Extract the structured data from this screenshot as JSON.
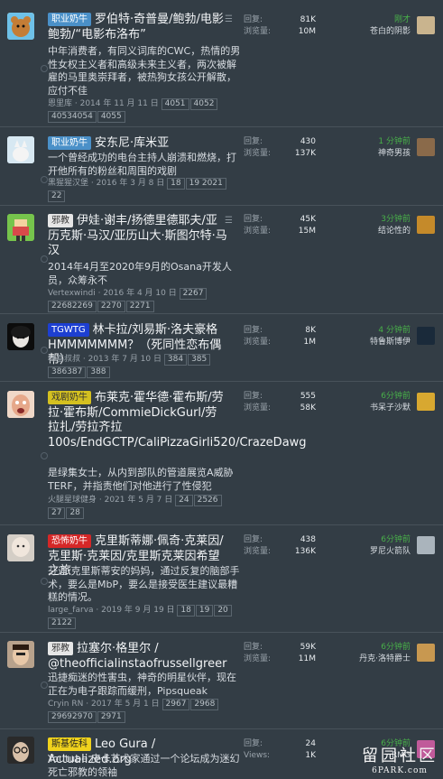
{
  "labels": {
    "replies": "回复:",
    "views": "浏览量:",
    "replies_en": "Views:"
  },
  "topics": [
    {
      "badge": "职业奶牛",
      "badge_color": "#4a90c8",
      "title": "罗伯特·奇普曼/鲍勃/电影鲍勃/“电影布洛布”",
      "snippet": "中年消费者，有同义词库的CWC，热情的男性女权主义者和高级未来主义者，两次被解雇的马里奥崇拜者，被热狗女孩公开解散，应付不佳",
      "author": "恩里库",
      "date": "2014 年 11 月 11 日",
      "pages": [
        "4051",
        "4052",
        "40534054",
        "4055"
      ],
      "replies": "81K",
      "views": "10M",
      "last_time": "刚才",
      "last_user": "苍白的阴影",
      "avatar_icon": "bear-avatar-icon"
    },
    {
      "badge": "职业奶牛",
      "badge_color": "#4a90c8",
      "title": "安东尼·库米亚",
      "snippet": "一个曾经成功的电台主持人崩溃和燃烧，打开他所有的粉丝和周围的戏剧",
      "author": "黑猩猩汉堡",
      "date": "2016 年 3 月 8 日",
      "pages": [
        "18",
        "19 2021",
        "22"
      ],
      "replies": "430",
      "views": "137K",
      "last_time": "1 分钟前",
      "last_user": "神奇男孩",
      "avatar_icon": "cat-avatar-icon"
    },
    {
      "badge": "邪教",
      "badge_color": "#e6e6e6",
      "title": "伊娃·谢丰/扬德里德耶夫/亚历克斯·马汉/亚历山大·斯图尔特·马汉",
      "snippet": "2014年4月至2020年9月的Osana开发人员，众筹永不",
      "author": "Vertexwindi",
      "date": "2016 年 4 月 10 日",
      "pages": [
        "2267",
        "22682269",
        "2270",
        "2271"
      ],
      "replies": "45K",
      "views": "15M",
      "last_time": "3分钟前",
      "last_user": "结论性的",
      "avatar_icon": "pixel-avatar-icon"
    },
    {
      "badge": "TGWTG",
      "badge_color": "#1d3fd1",
      "title": "林卡拉/刘易斯·洛夫豪格HMMMMMMM？（死同性恋布偶帮）",
      "snippet": "",
      "author": "林基叔叔",
      "date": "2013 年 7 月 10 日",
      "pages": [
        "384",
        "385",
        "386387",
        "388"
      ],
      "replies": "8K",
      "views": "1M",
      "last_time": "4 分钟前",
      "last_user": "特鲁斯博伊",
      "avatar_icon": "puppet-avatar-icon"
    },
    {
      "badge": "戏剧奶牛",
      "badge_color": "#d4c020",
      "title": "布莱克·霍华德·霍布斯/劳拉·霍布斯/CommieDickGurl/劳拉扎/劳拉齐拉100s/EndGCTP/CaliPizzaGirli520/CrazeDawg",
      "snippet": "是绿集女士，从内到部队的管道展览A威胁TERF，并指责他们对他进行了性侵犯",
      "author": "火腿星球健身",
      "date": "2021 年 5 月 7 日",
      "pages": [
        "24",
        "2526",
        "27",
        "28"
      ],
      "replies": "555",
      "views": "58K",
      "last_time": "6分钟前",
      "last_user": "书呆子沙默",
      "avatar_icon": "face-avatar-icon"
    },
    {
      "badge": "恐怖奶牛",
      "badge_color": "#d52727",
      "title": "克里斯蒂娜·佩奇·克莱因/克里斯·克莱因/克里斯克莱因希望之旅",
      "snippet": "芬迪·克里斯蒂安的妈妈，通过反复的脑部手术，要么是MbP，要么是接受医生建议最糟糕的情况。",
      "author": "large_farva",
      "date": "2019 年 9 月 19 日",
      "pages": [
        "18",
        "19",
        "20",
        "2122"
      ],
      "replies": "438",
      "views": "136K",
      "last_time": "6分钟前",
      "last_user": "罗尼火箭队",
      "avatar_icon": "woman-avatar-icon"
    },
    {
      "badge": "邪教",
      "badge_color": "#e6e6e6",
      "title": "拉塞尔·格里尔 / @theofficialinstaofrussellgreer",
      "snippet": "迅捷痴迷的性害虫，神奇的明星伙伴，现在正在为电子跟踪而缓刑，Pipsqueak",
      "author": "Cryin RN",
      "date": "2017 年 5 月 1 日",
      "pages": [
        "2967",
        "2968",
        "29692970",
        "2971"
      ],
      "replies": "59K",
      "views": "11M",
      "last_time": "6分钟前",
      "last_user": "丹克·洛特爵士",
      "avatar_icon": "man-avatar-icon"
    },
    {
      "badge": "斯基佐科",
      "badge_color": "#f0d21c",
      "title": "Leo Gura / Actualized.org",
      "snippet": "Youtube 皮卡艺术家通过一个论坛成为迷幻死亡邪教的领袖",
      "author": "",
      "date": "",
      "pages": [],
      "replies": "24",
      "views": "1K",
      "last_time": "6分钟前",
      "last_user": "RMG",
      "avatar_icon": "glasses-avatar-icon"
    }
  ],
  "watermark": {
    "cn": "留园社区",
    "en": "6PARK.com"
  }
}
